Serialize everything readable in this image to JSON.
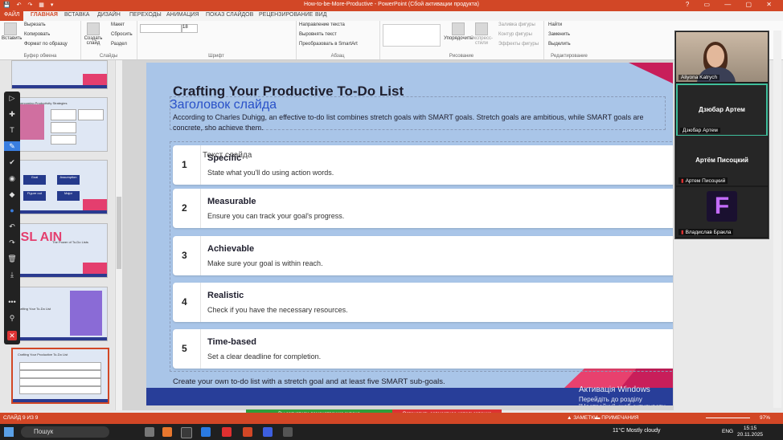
{
  "window": {
    "title": "How-to-be-More-Productive - PowerPoint (Сбой активации продукта)",
    "qat": "💾 ↶ ↷ ▦ ▾",
    "controls": "? ▭ — ▢ ✕"
  },
  "tabs": [
    {
      "label": "ФАЙЛ"
    },
    {
      "label": "ГЛАВНАЯ"
    },
    {
      "label": "ВСТАВКА"
    },
    {
      "label": "ДИЗАЙН"
    },
    {
      "label": "ПЕРЕХОДЫ"
    },
    {
      "label": "АНИМАЦИЯ"
    },
    {
      "label": "ПОКАЗ СЛАЙДОВ"
    },
    {
      "label": "РЕЦЕНЗИРОВАНИЕ"
    },
    {
      "label": "ВИД"
    }
  ],
  "ribbon": {
    "clipboard": {
      "paste": "Вставить",
      "cut": "Вырезать",
      "copy": "Копировать",
      "format": "Формат по образцу",
      "group": "Буфер обмена"
    },
    "slides": {
      "new": "Создать слайд",
      "layout": "Макет",
      "reset": "Сбросить",
      "section": "Раздел",
      "group": "Слайды"
    },
    "font": {
      "size": "18",
      "group": "Шрифт"
    },
    "paragraph": {
      "direction": "Направление текста",
      "align": "Выровнять текст",
      "smartart": "Преобразовать в SmartArt",
      "group": "Абзац"
    },
    "drawing": {
      "arrange": "Упорядочить",
      "styles": "Экспресс-стили",
      "fill": "Заливка фигуры",
      "outline": "Контур фигуры",
      "effects": "Эффекты фигуры",
      "group": "Рисование"
    },
    "editing": {
      "find": "Найти",
      "replace": "Заменить",
      "select": "Выделить",
      "group": "Редактирование"
    }
  },
  "thumbnails": [
    {
      "num": "",
      "title": ""
    },
    {
      "num": "",
      "title": "Overcoming Productivity Strategies"
    },
    {
      "num": "",
      "title": "",
      "blocks": [
        "Goal",
        "Assumption",
        "Figure out",
        "Major"
      ]
    },
    {
      "num": "",
      "title": "The Power of To-Do Lists",
      "big": "ESL AIN"
    },
    {
      "num": "",
      "title": "Crafting Your To-Do List"
    },
    {
      "num": "9",
      "title": "Crafting Your Productive To-Do List"
    }
  ],
  "pen_tools": [
    "▷",
    "✚",
    "T",
    "✎",
    "✔",
    "◉",
    "◆",
    "●",
    "↶",
    "↷",
    "🗑",
    "⤓",
    "•••",
    "⚲",
    "✕"
  ],
  "slide": {
    "title": "Crafting Your Productive To-Do List",
    "placeholder_title": "Заголовок слайда",
    "placeholder_text": "Текст слайда",
    "intro": "According to Charles Duhigg, an effective to-do list combines stretch goals with SMART goals. Stretch goals are ambitious, while SMART goals are concrete, sho achieve them.",
    "steps": [
      {
        "num": "1",
        "heading": "Specific",
        "desc": "State what you'll do using action words."
      },
      {
        "num": "2",
        "heading": "Measurable",
        "desc": "Ensure you can track your goal's progress."
      },
      {
        "num": "3",
        "heading": "Achievable",
        "desc": "Make sure your goal is within reach."
      },
      {
        "num": "4",
        "heading": "Realistic",
        "desc": "Check if you have the necessary resources."
      },
      {
        "num": "5",
        "heading": "Time-based",
        "desc": "Set a clear deadline for completion."
      }
    ],
    "footer": "Create your own to-do list with a stretch goal and at least five SMART sub-goals."
  },
  "activation": {
    "line1": "Активація Windows",
    "line2": "Перейдіть до розділу \"Настройки\", щоб активувати Windows."
  },
  "participants": [
    {
      "name": "Aliyona Katrych",
      "type": "video"
    },
    {
      "name": "Дзюбар Артем",
      "caption": "Дзюбар Артем",
      "speaking": true
    },
    {
      "name": "Артём Писоцкий",
      "caption": "Артем Писоцкий",
      "muted": true
    },
    {
      "name": "Владислав Бракла",
      "caption": "Владислав Бракла",
      "avatar_letter": "F",
      "muted": true
    }
  ],
  "statusbar": {
    "slide_counter": "СЛАЙД 9 ИЗ 9",
    "notes": "▲ ЗАМЕТКИ",
    "comments": "▬ ПРИМЕЧАНИЯ",
    "zoom": "97%"
  },
  "screenshare": {
    "status": "Вы запустили демонстрацию экрана",
    "stop": "Остановить совместное использование"
  },
  "taskbar": {
    "search": "Пошук",
    "weather": "11°C  Mostly cloudy",
    "lang": "ENG",
    "time": "15:15",
    "date": "20.11.2025"
  },
  "colors": {
    "accent": "#d24726",
    "slide_bg": "#a9c5e8",
    "navy": "#283e99",
    "pink": "#e8416e",
    "speaking": "#3fbf9c"
  }
}
